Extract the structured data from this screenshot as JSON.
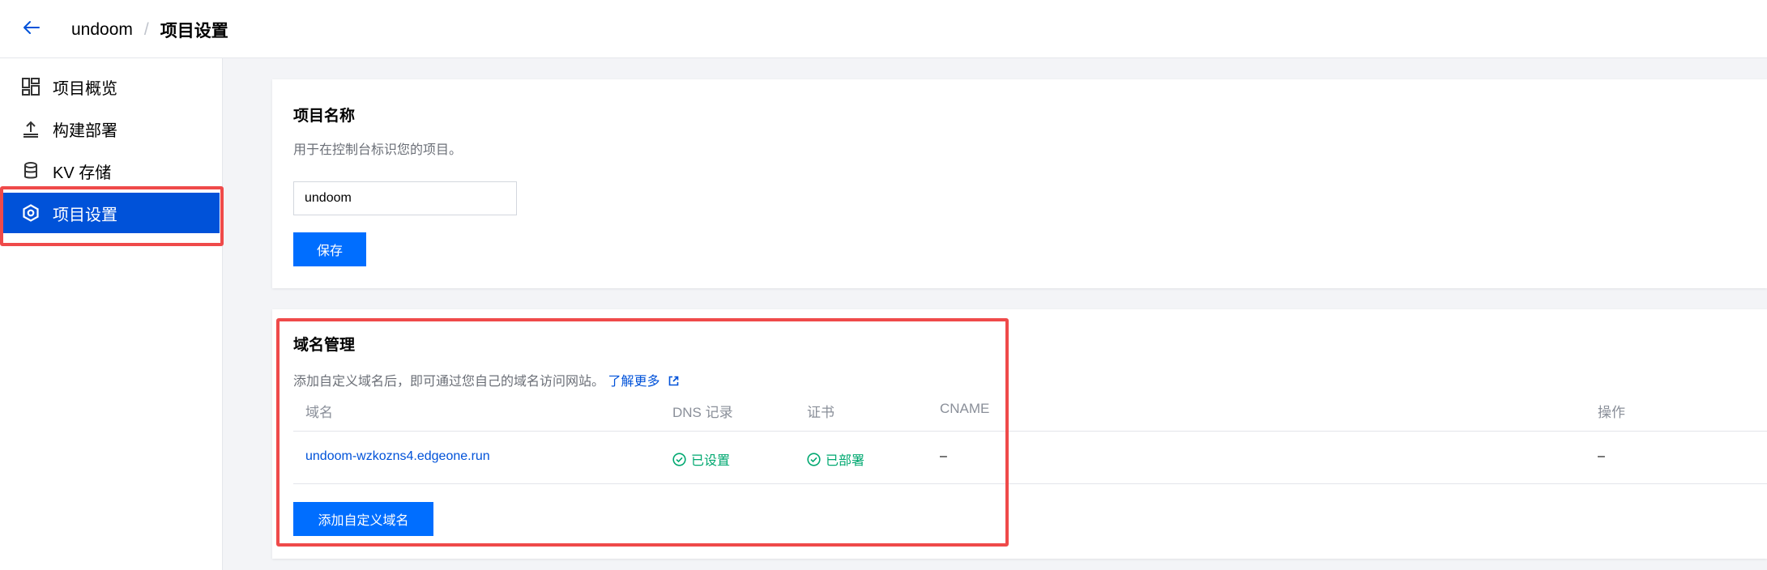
{
  "header": {
    "project": "undoom",
    "separator": "/",
    "current": "项目设置"
  },
  "sidebar": {
    "items": [
      {
        "label": "项目概览",
        "icon": "dashboard-icon"
      },
      {
        "label": "构建部署",
        "icon": "upload-icon"
      },
      {
        "label": "KV 存储",
        "icon": "database-icon"
      },
      {
        "label": "项目设置",
        "icon": "settings-hexagon-icon",
        "active": true
      }
    ]
  },
  "project_name_card": {
    "title": "项目名称",
    "description": "用于在控制台标识您的项目。",
    "input_value": "undoom",
    "save_label": "保存"
  },
  "domain_card": {
    "title": "域名管理",
    "description": "添加自定义域名后，即可通过您自己的域名访问网站。",
    "learn_more": "了解更多",
    "columns": [
      "域名",
      "DNS 记录",
      "证书",
      "CNAME",
      "操作"
    ],
    "rows": [
      {
        "domain": "undoom-wzkozns4.edgeone.run",
        "dns": "已设置",
        "cert": "已部署",
        "cname": "–",
        "action": "–"
      }
    ],
    "add_label": "添加自定义域名"
  },
  "colors": {
    "accent": "#006eff",
    "active_nav": "#0052d9",
    "success": "#00a870",
    "highlight": "#ef4a4a"
  }
}
